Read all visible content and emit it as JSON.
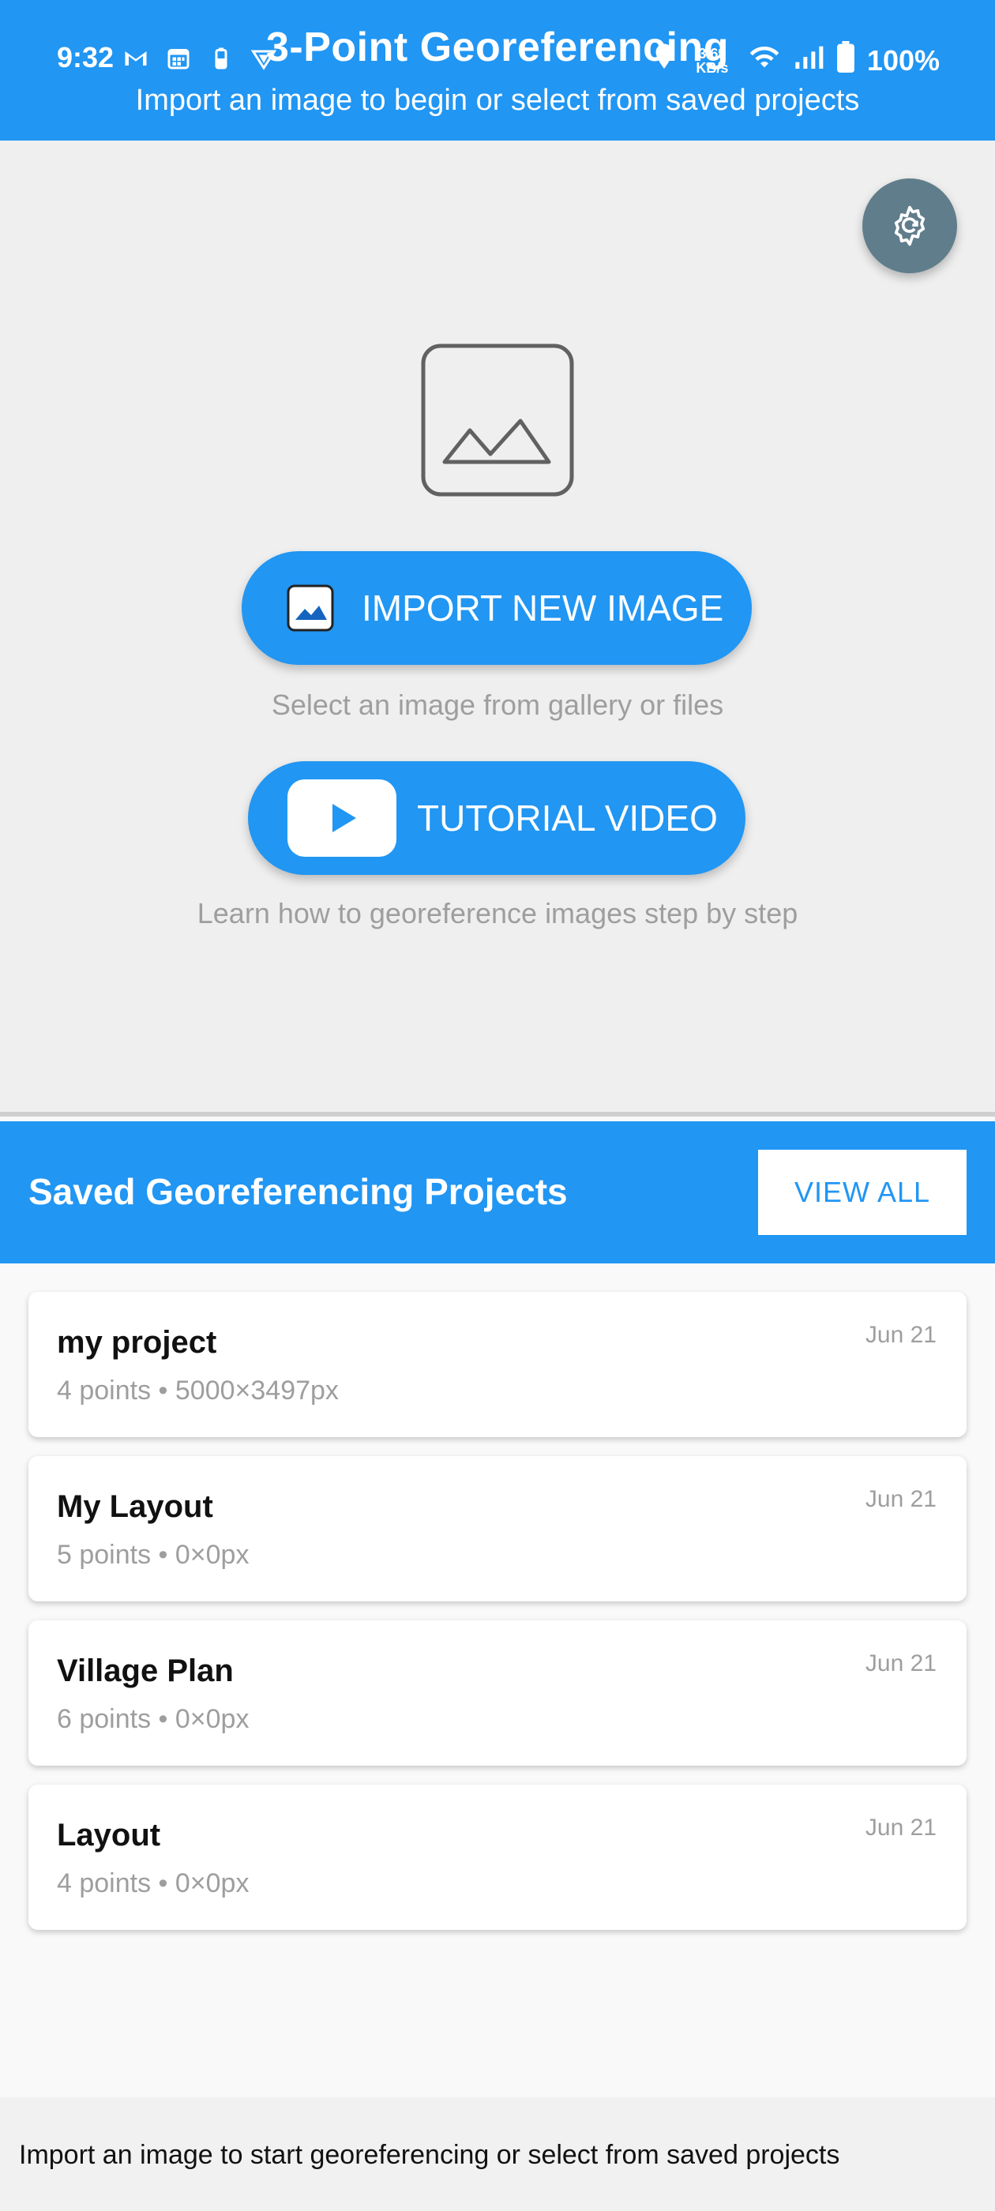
{
  "status_bar": {
    "time": "9:32",
    "left_icons": [
      "gmail-icon",
      "calendar-icon",
      "battery-saver-icon",
      "vpn-icon"
    ],
    "speed_line1": "3.69",
    "speed_line2": "KB/s",
    "network_tag": "NR",
    "battery": "100%"
  },
  "header": {
    "title": "3-Point Georeferencing",
    "subtitle": "Import an image to begin or select from saved projects",
    "color": "#2196f3"
  },
  "hero": {
    "settings_icon": "settings-sync-icon",
    "placeholder_icon": "image-placeholder-icon",
    "import_button_label": "IMPORT NEW IMAGE",
    "import_hint": "Select an image from gallery or files",
    "tutorial_button_label": "TUTORIAL VIDEO",
    "tutorial_hint": "Learn how to georeference images step by step"
  },
  "saved": {
    "title": "Saved Georeferencing Projects",
    "view_all_label": "VIEW ALL",
    "projects": [
      {
        "name": "my project",
        "meta": "4 points • 5000×3497px",
        "date": "Jun 21"
      },
      {
        "name": "My Layout",
        "meta": "5 points • 0×0px",
        "date": "Jun 21"
      },
      {
        "name": "Village Plan",
        "meta": "6 points • 0×0px",
        "date": "Jun 21"
      },
      {
        "name": "Layout",
        "meta": "4 points • 0×0px",
        "date": "Jun 21"
      }
    ]
  },
  "footer": {
    "text": "Import an image to start georeferencing or select from saved projects"
  }
}
